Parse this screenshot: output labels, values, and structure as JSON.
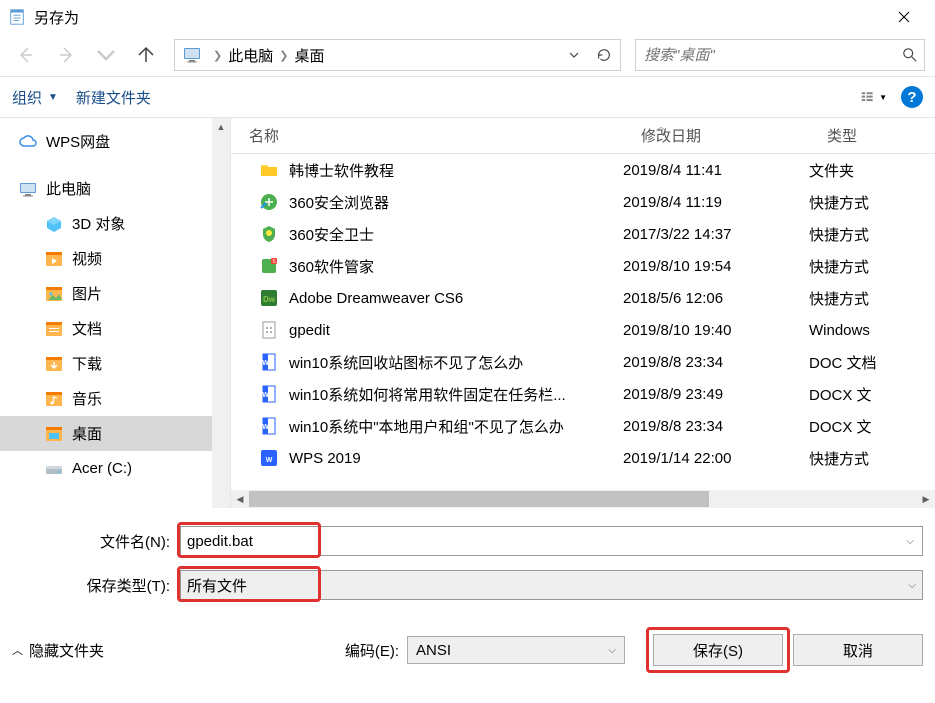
{
  "title": "另存为",
  "breadcrumb": {
    "root": "此电脑",
    "current": "桌面"
  },
  "search_placeholder": "搜索\"桌面\"",
  "toolbar": {
    "organize": "组织",
    "newfolder": "新建文件夹"
  },
  "sidebar": {
    "items": [
      {
        "label": "WPS网盘",
        "icon": "cloud"
      },
      {
        "label": "此电脑",
        "icon": "pc"
      },
      {
        "label": "3D 对象",
        "icon": "3d"
      },
      {
        "label": "视频",
        "icon": "video"
      },
      {
        "label": "图片",
        "icon": "pic"
      },
      {
        "label": "文档",
        "icon": "doc"
      },
      {
        "label": "下载",
        "icon": "dl"
      },
      {
        "label": "音乐",
        "icon": "music"
      },
      {
        "label": "桌面",
        "icon": "desk",
        "selected": true
      },
      {
        "label": "Acer (C:)",
        "icon": "drive"
      }
    ]
  },
  "columns": {
    "name": "名称",
    "date": "修改日期",
    "type": "类型"
  },
  "files": {
    "rows": [
      {
        "name": "韩博士软件教程",
        "date": "2019/8/4 11:41",
        "type": "文件夹",
        "icon": "folder"
      },
      {
        "name": "360安全浏览器",
        "date": "2019/8/4 11:19",
        "type": "快捷方式",
        "icon": "lnk1"
      },
      {
        "name": "360安全卫士",
        "date": "2017/3/22 14:37",
        "type": "快捷方式",
        "icon": "lnk2"
      },
      {
        "name": "360软件管家",
        "date": "2019/8/10 19:54",
        "type": "快捷方式",
        "icon": "lnk3"
      },
      {
        "name": "Adobe Dreamweaver CS6",
        "date": "2018/5/6 12:06",
        "type": "快捷方式",
        "icon": "lnk4"
      },
      {
        "name": "gpedit",
        "date": "2019/8/10 19:40",
        "type": "Windows",
        "icon": "bat"
      },
      {
        "name": "win10系统回收站图标不见了怎么办",
        "date": "2019/8/8 23:34",
        "type": "DOC 文档",
        "icon": "docw"
      },
      {
        "name": "win10系统如何将常用软件固定在任务栏...",
        "date": "2019/8/9 23:49",
        "type": "DOCX 文",
        "icon": "docw"
      },
      {
        "name": "win10系统中\"本地用户和组\"不见了怎么办",
        "date": "2019/8/8 23:34",
        "type": "DOCX 文",
        "icon": "docw"
      },
      {
        "name": "WPS 2019",
        "date": "2019/1/14 22:00",
        "type": "快捷方式",
        "icon": "lnk5"
      }
    ]
  },
  "form": {
    "filename_label": "文件名(N):",
    "filename_value": "gpedit.bat",
    "type_label": "保存类型(T):",
    "type_value": "所有文件",
    "encoding_label": "编码(E):",
    "encoding_value": "ANSI"
  },
  "buttons": {
    "hide_folders": "隐藏文件夹",
    "save": "保存(S)",
    "cancel": "取消"
  }
}
